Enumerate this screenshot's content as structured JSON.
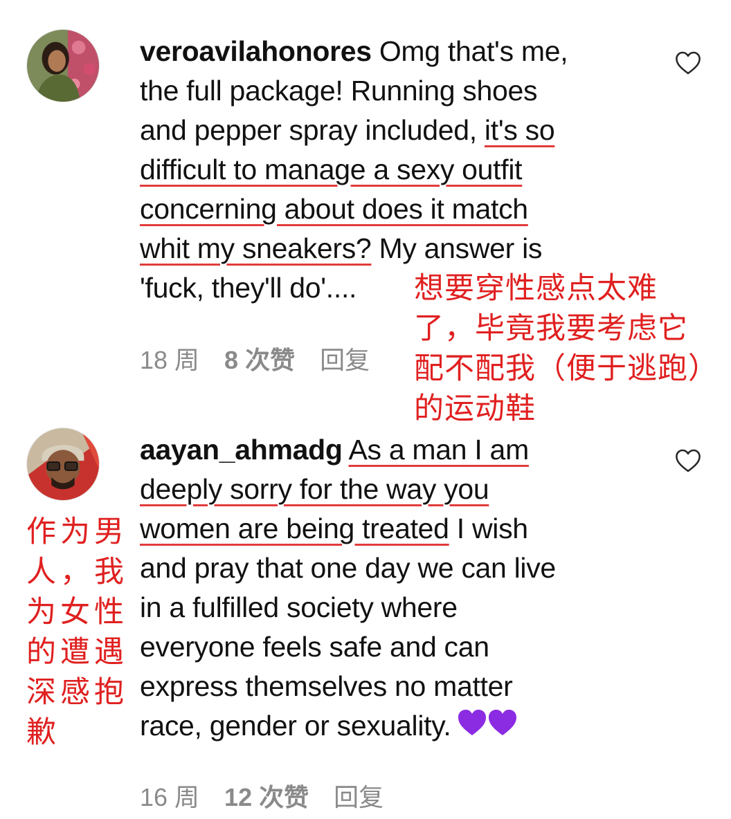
{
  "comments": [
    {
      "username": "veroavilahonores",
      "text_parts": [
        "Omg that's me,",
        "the full package! Running shoes",
        "and pepper spray included, ",
        "it's so",
        "difficult to manage a sexy outfit",
        "concerning about does it match",
        "whit my sneakers?",
        " My answer is",
        "'fuck, they'll do'...."
      ],
      "time": "18 周",
      "likes": "8 次赞",
      "reply": "回复",
      "annotation": "想要穿性感点太难了，毕竟我要考虑它配不配我（便于逃跑）的运动鞋"
    },
    {
      "username": "aayan_ahmadg",
      "text_parts": [
        "As a man I am",
        "deeply sorry for the way you",
        "women are being treated",
        " I wish",
        "and pray that one day we can live",
        "in a fulfilled society where",
        "everyone feels safe and can",
        "express themselves no matter",
        "race, gender or sexuality."
      ],
      "emoji": "💜💜",
      "time": "16 周",
      "likes": "12 次赞",
      "reply": "回复",
      "annotation": "作为男人，我为女性的遭遇深感抱歉"
    }
  ],
  "colors": {
    "annotation": "#e02020",
    "underline": "#e23b3b",
    "meta": "#8a8a8a",
    "emoji_heart": "#8b2be2"
  },
  "icons": {
    "like": "heart-outline-icon",
    "emoji": "purple-heart-emoji"
  }
}
